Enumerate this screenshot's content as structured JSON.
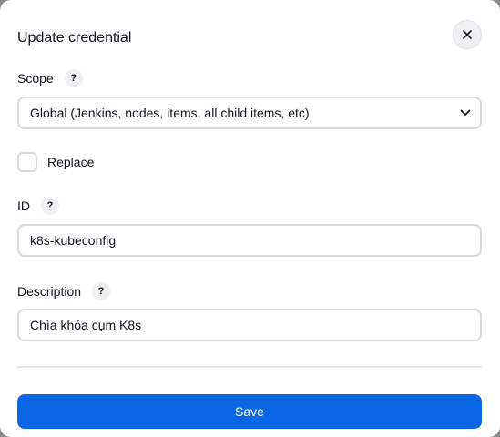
{
  "dialog": {
    "title": "Update credential"
  },
  "scope": {
    "label": "Scope",
    "help": "?",
    "selected": "Global (Jenkins, nodes, items, all child items, etc)"
  },
  "replace": {
    "label": "Replace",
    "checked": false
  },
  "id_field": {
    "label": "ID",
    "help": "?",
    "value": "k8s-kubeconfig"
  },
  "description": {
    "label": "Description",
    "help": "?",
    "value": "Chìa khóa cụm K8s"
  },
  "actions": {
    "save_label": "Save"
  },
  "icons": {
    "close": "close-icon",
    "chevron": "chevron-down-icon"
  },
  "colors": {
    "primary": "#0b66e4",
    "border": "#d7dbe1",
    "help_bg": "#eef0f3"
  }
}
